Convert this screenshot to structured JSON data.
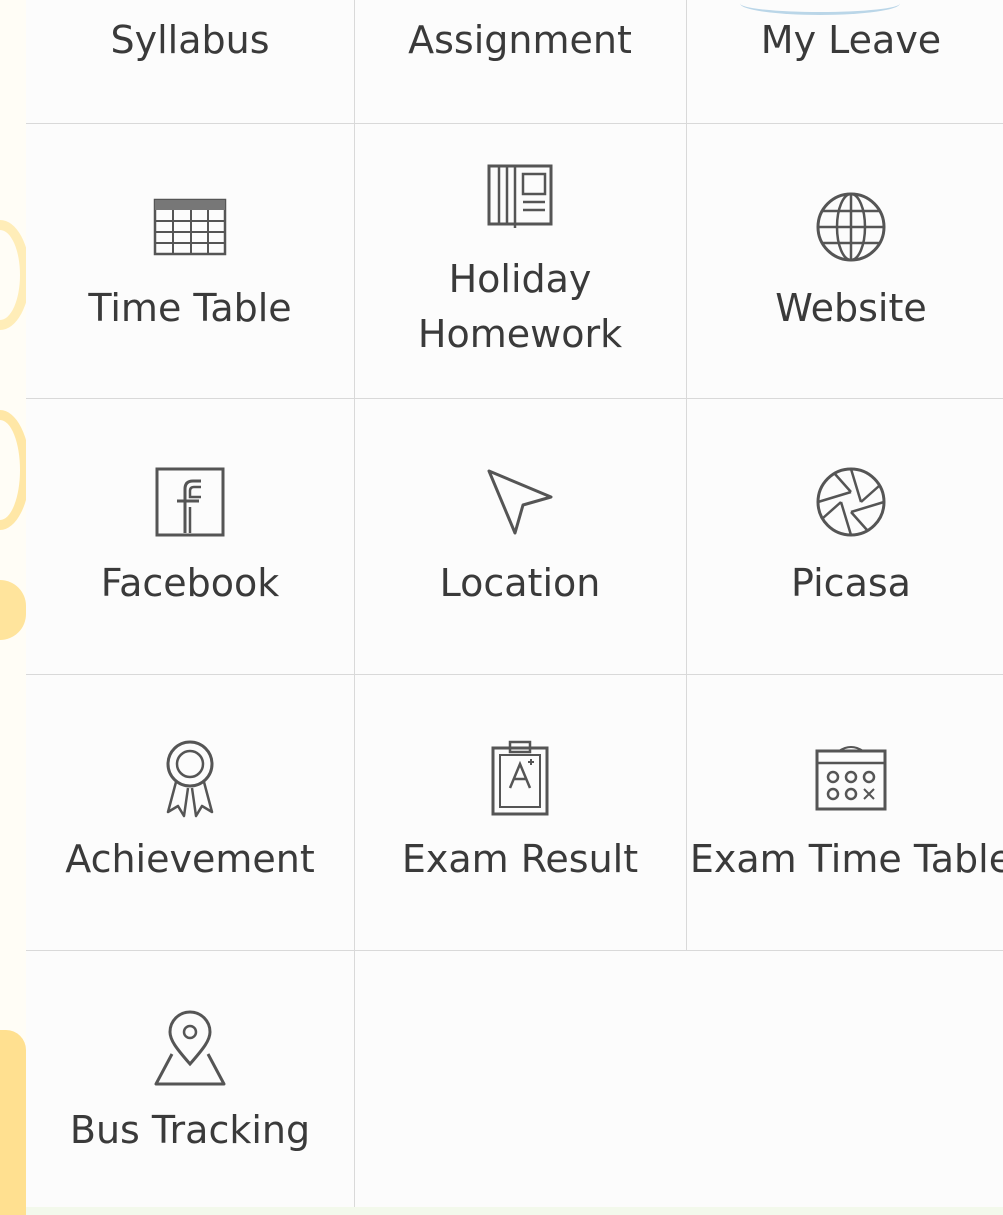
{
  "menu": {
    "items": [
      {
        "id": "syllabus",
        "label": "Syllabus",
        "icon": "syllabus-icon"
      },
      {
        "id": "assignment",
        "label": "Assignment",
        "icon": "assignment-icon"
      },
      {
        "id": "my-leave",
        "label": "My Leave",
        "icon": "leave-icon"
      },
      {
        "id": "time-table",
        "label": "Time Table",
        "icon": "timetable-icon"
      },
      {
        "id": "holiday-homework",
        "label": "Holiday Homework",
        "icon": "notebook-icon"
      },
      {
        "id": "website",
        "label": "Website",
        "icon": "globe-icon"
      },
      {
        "id": "facebook",
        "label": "Facebook",
        "icon": "facebook-icon"
      },
      {
        "id": "location",
        "label": "Location",
        "icon": "pointer-arrow-icon"
      },
      {
        "id": "picasa",
        "label": "Picasa",
        "icon": "picasa-icon"
      },
      {
        "id": "achievement",
        "label": "Achievement",
        "icon": "award-ribbon-icon"
      },
      {
        "id": "exam-result",
        "label": "Exam Result",
        "icon": "clipboard-grade-icon"
      },
      {
        "id": "exam-time-table",
        "label": "Exam Time Table",
        "icon": "calendar-icon"
      },
      {
        "id": "bus-tracking",
        "label": "Bus Tracking",
        "icon": "map-pin-icon"
      }
    ]
  },
  "colors": {
    "text": "#3a3a3a",
    "grid_line": "#d9d9d9",
    "icon": "#555555",
    "watermark": "#ffe49c"
  }
}
